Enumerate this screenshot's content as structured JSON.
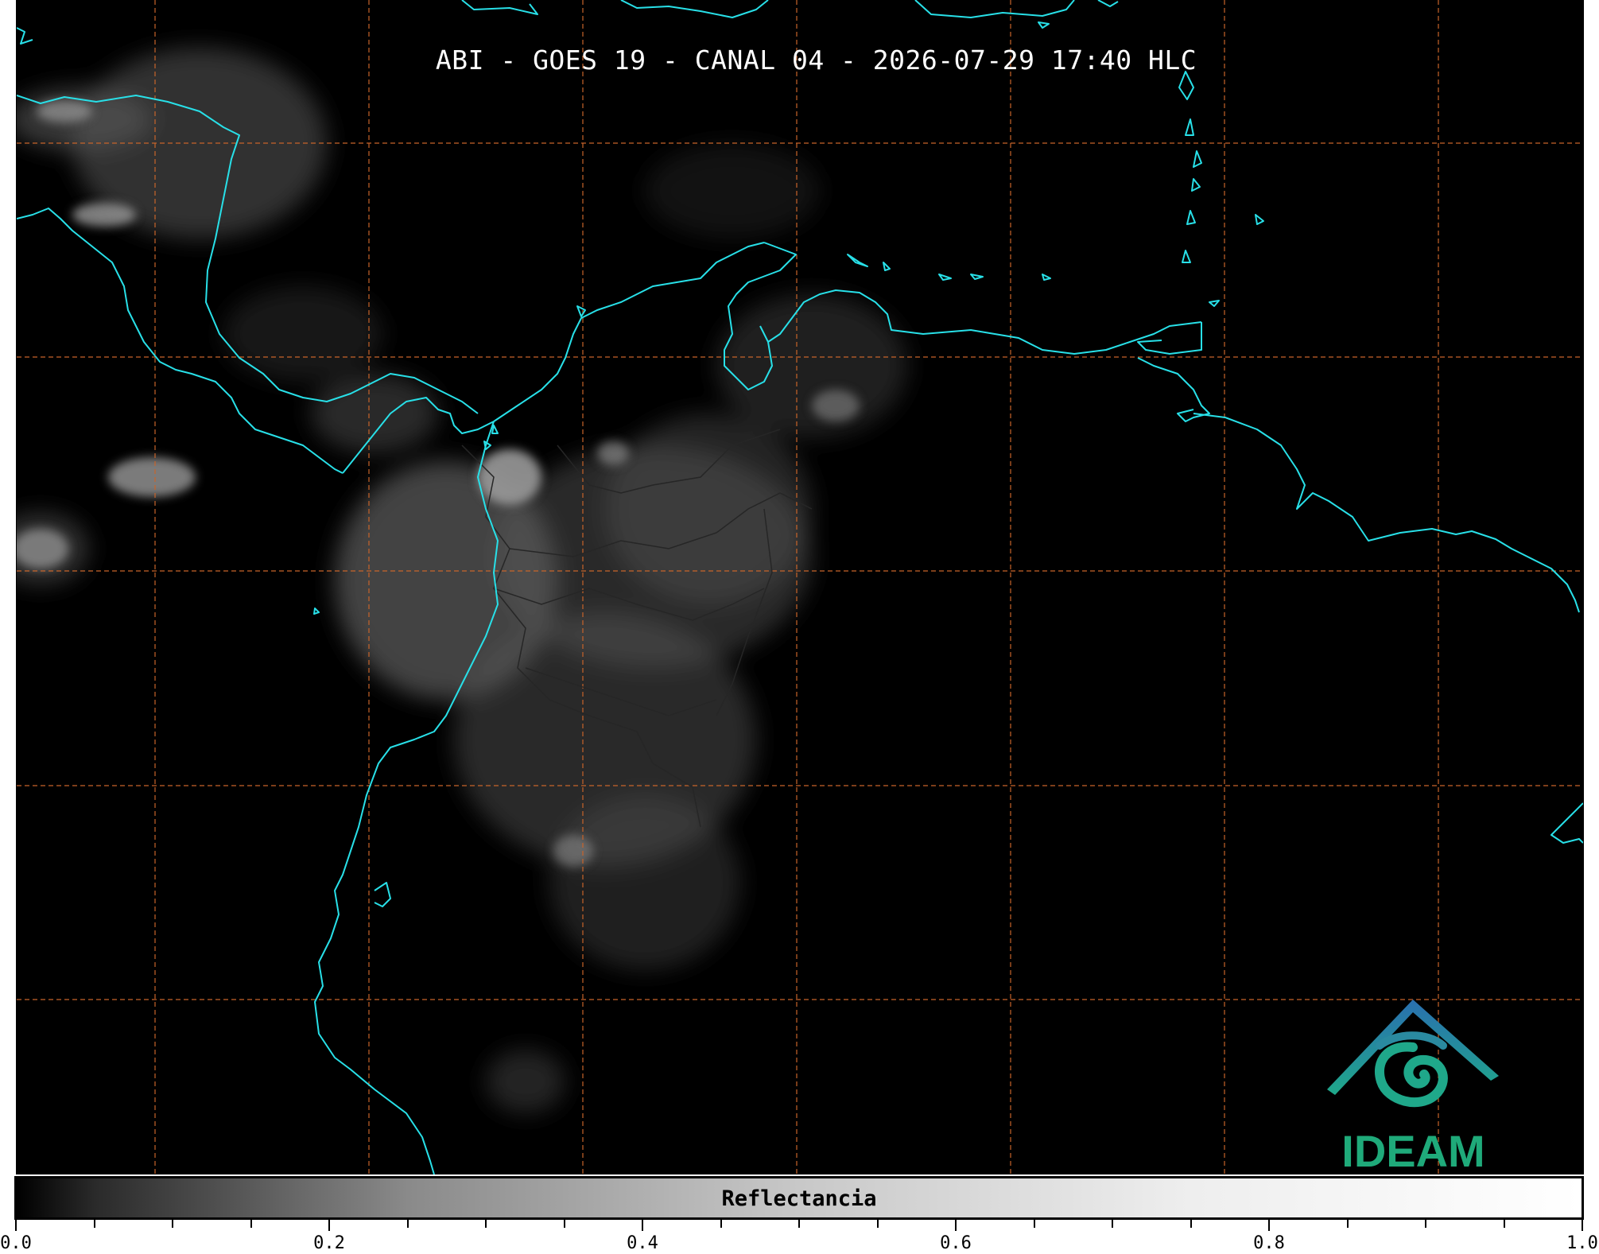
{
  "title": "ABI - GOES 19 - CANAL 04 - 2026-07-29 17:40 HLC",
  "colorbar": {
    "label": "Reflectancia",
    "tick_labels": [
      "0.0",
      "0.2",
      "0.4",
      "0.6",
      "0.8",
      "1.0"
    ],
    "range": [
      0.0,
      1.0
    ],
    "colors": {
      "low": "#000000",
      "high": "#ffffff"
    }
  },
  "logo": {
    "text": "IDEAM",
    "colors": {
      "roof": "#2a6fb0",
      "swirl": "#1fa88a",
      "text": "#1faa7a"
    }
  },
  "map_style": {
    "background": "#000000",
    "coastline_color": "#28e0e8",
    "border_color": "#2a2a2a",
    "gridline_color": "#c8642a",
    "gridline_style": "dashed"
  }
}
